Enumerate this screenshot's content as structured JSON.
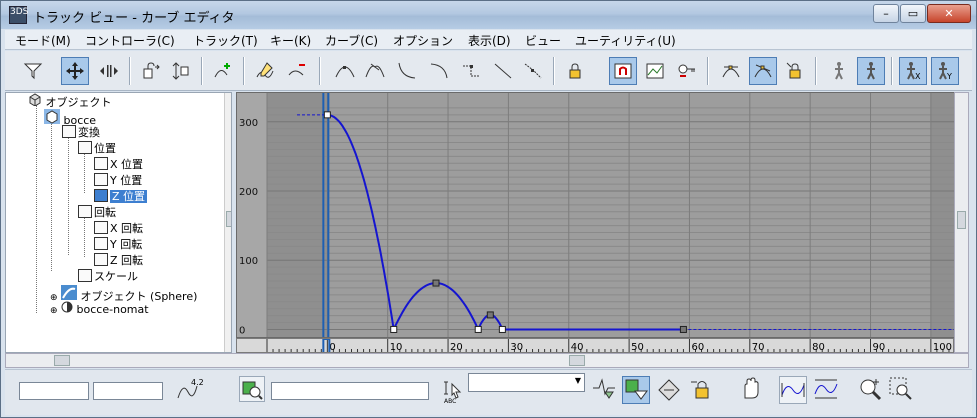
{
  "window": {
    "title": "トラック ビュー - カーブ エディタ",
    "app_icon_text": "3DS",
    "minimize": "–",
    "maximize": "▭",
    "close": "✕"
  },
  "menu": [
    "モード(M)",
    "コントローラ(C)",
    "トラック(T)",
    "キー(K)",
    "カーブ(C)",
    "オプション",
    "表示(D)",
    "ビュー",
    "ユーティリティ(U)"
  ],
  "toolbar_icons": [
    "filter-icon",
    "move-keys-icon",
    "slide-keys-icon",
    "scale-keys-icon",
    "scale-values-icon",
    "add-keys-icon",
    "draw-curves-icon",
    "reduce-keys-icon",
    "tangent-auto-icon",
    "tangent-custom-icon",
    "tangent-fast-icon",
    "tangent-slow-icon",
    "tangent-step-icon",
    "tangent-linear-icon",
    "tangent-smooth-icon",
    "lock-tangents-icon",
    "show-snap-icon",
    "parameter-curve-icon",
    "key-icon",
    "show-tangents-icon",
    "show-all-tangents-icon",
    "lock-selection-icon",
    "biped-icon",
    "biped-pos-icon",
    "biped-x-icon",
    "biped-y-icon"
  ],
  "tree": {
    "items": [
      {
        "label": "オブジェクト",
        "icon": "objects-icon",
        "selected": false
      },
      {
        "label": "bocce",
        "icon": "box-icon",
        "selected": false
      },
      {
        "label": "変換",
        "icon": "transform-icon",
        "selected": false
      },
      {
        "label": "位置",
        "icon": "position-icon",
        "selected": false
      },
      {
        "label": "X 位置",
        "icon": "curve-icon",
        "selected": false
      },
      {
        "label": "Y 位置",
        "icon": "curve-icon",
        "selected": false
      },
      {
        "label": "Z 位置",
        "icon": "curve-icon",
        "selected": true
      },
      {
        "label": "回転",
        "icon": "rotation-icon",
        "selected": false
      },
      {
        "label": "X 回転",
        "icon": "curve-icon",
        "selected": false
      },
      {
        "label": "Y 回転",
        "icon": "curve-icon",
        "selected": false
      },
      {
        "label": "Z 回転",
        "icon": "curve-icon",
        "selected": false
      },
      {
        "label": "スケール",
        "icon": "scale-icon",
        "selected": false
      },
      {
        "label": "オブジェクト (Sphere)",
        "icon": "sphere-icon",
        "selected": false
      },
      {
        "label": "bocce-nomat",
        "icon": "object-icon",
        "selected": false
      }
    ]
  },
  "chart_data": {
    "type": "line",
    "title": "",
    "xlabel": "",
    "ylabel": "",
    "xlim": [
      -10,
      104
    ],
    "ylim": [
      -8,
      330
    ],
    "x_ticks": [
      0,
      10,
      20,
      30,
      40,
      50,
      60,
      70,
      80,
      90,
      100
    ],
    "y_ticks": [
      0,
      100,
      200,
      300
    ],
    "grid": true,
    "series": [
      {
        "name": "",
        "color": "#1515d0",
        "keys": [
          {
            "x": 0,
            "y": 310
          },
          {
            "x": 11,
            "y": 0
          },
          {
            "x": 18,
            "y": 67
          },
          {
            "x": 25,
            "y": 0
          },
          {
            "x": 27,
            "y": 21
          },
          {
            "x": 29,
            "y": 0
          },
          {
            "x": 59,
            "y": 0
          }
        ]
      }
    ],
    "current_frame": 0
  },
  "status": {
    "field1": "",
    "field2": "",
    "frame_value": "4.2",
    "name_field": "",
    "dropdown_value": ""
  },
  "colors": {
    "graph_bg": "#9d9d9d",
    "curve": "#1515d0",
    "selection": "#3d7fd0"
  }
}
